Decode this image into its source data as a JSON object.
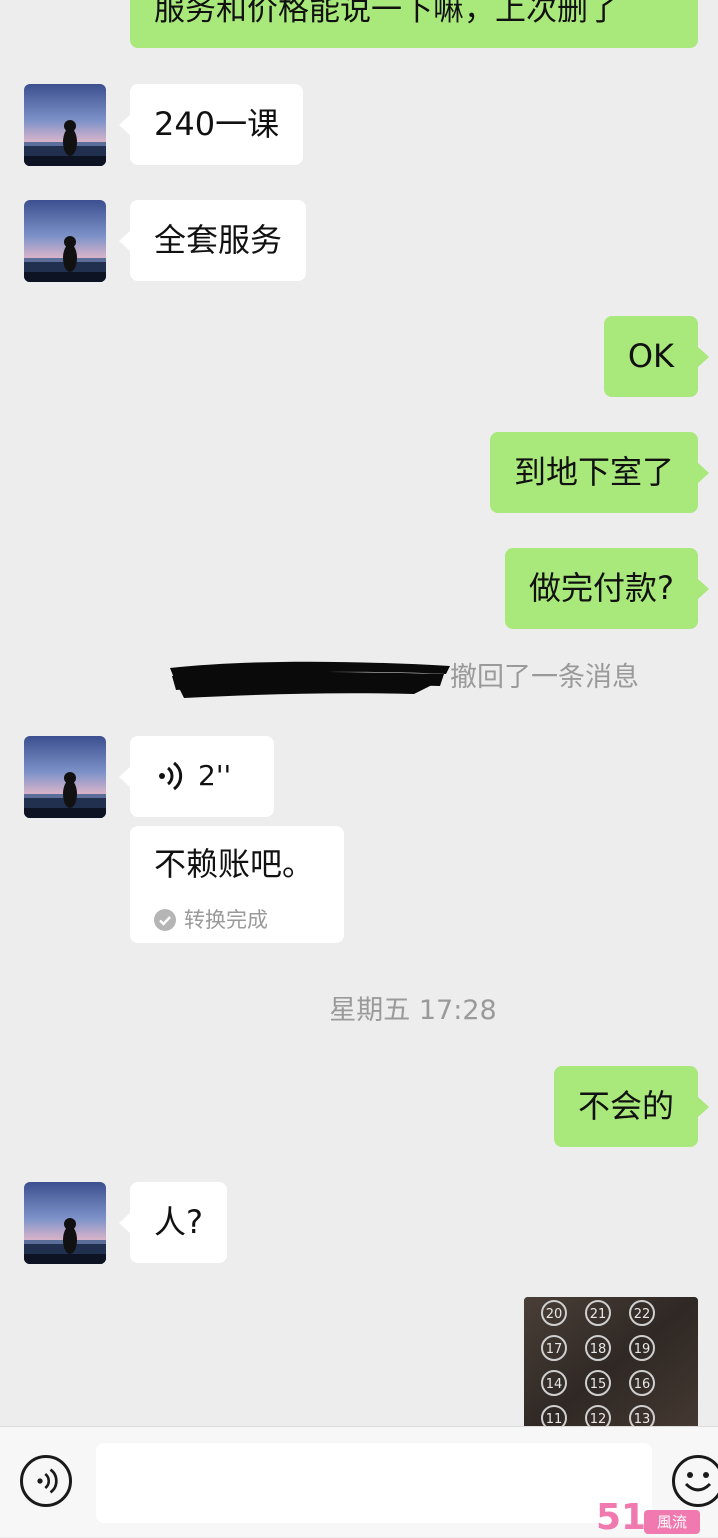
{
  "messages": {
    "top_partial": "服务和价格能说一下嘛，上次删了",
    "m1": "240一课",
    "m2": "全套服务",
    "m3": "OK",
    "m4": "到地下室了",
    "m5": "做完付款?",
    "recall_notice": "撤回了一条消息",
    "voice_duration": "2''",
    "voice_transcript": "不赖账吧。",
    "transcript_status": "转换完成",
    "timestamp": "星期五 17:28",
    "m6": "不会的",
    "m7": "人?"
  },
  "elevator_buttons": [
    "20",
    "21",
    "22",
    "17",
    "18",
    "19",
    "14",
    "15",
    "16",
    "11",
    "12",
    "13"
  ],
  "watermark": {
    "number": "51",
    "tag": "風流"
  },
  "colors": {
    "incoming": "#ffffff",
    "outgoing": "#a9e87a",
    "background": "#ededed"
  }
}
